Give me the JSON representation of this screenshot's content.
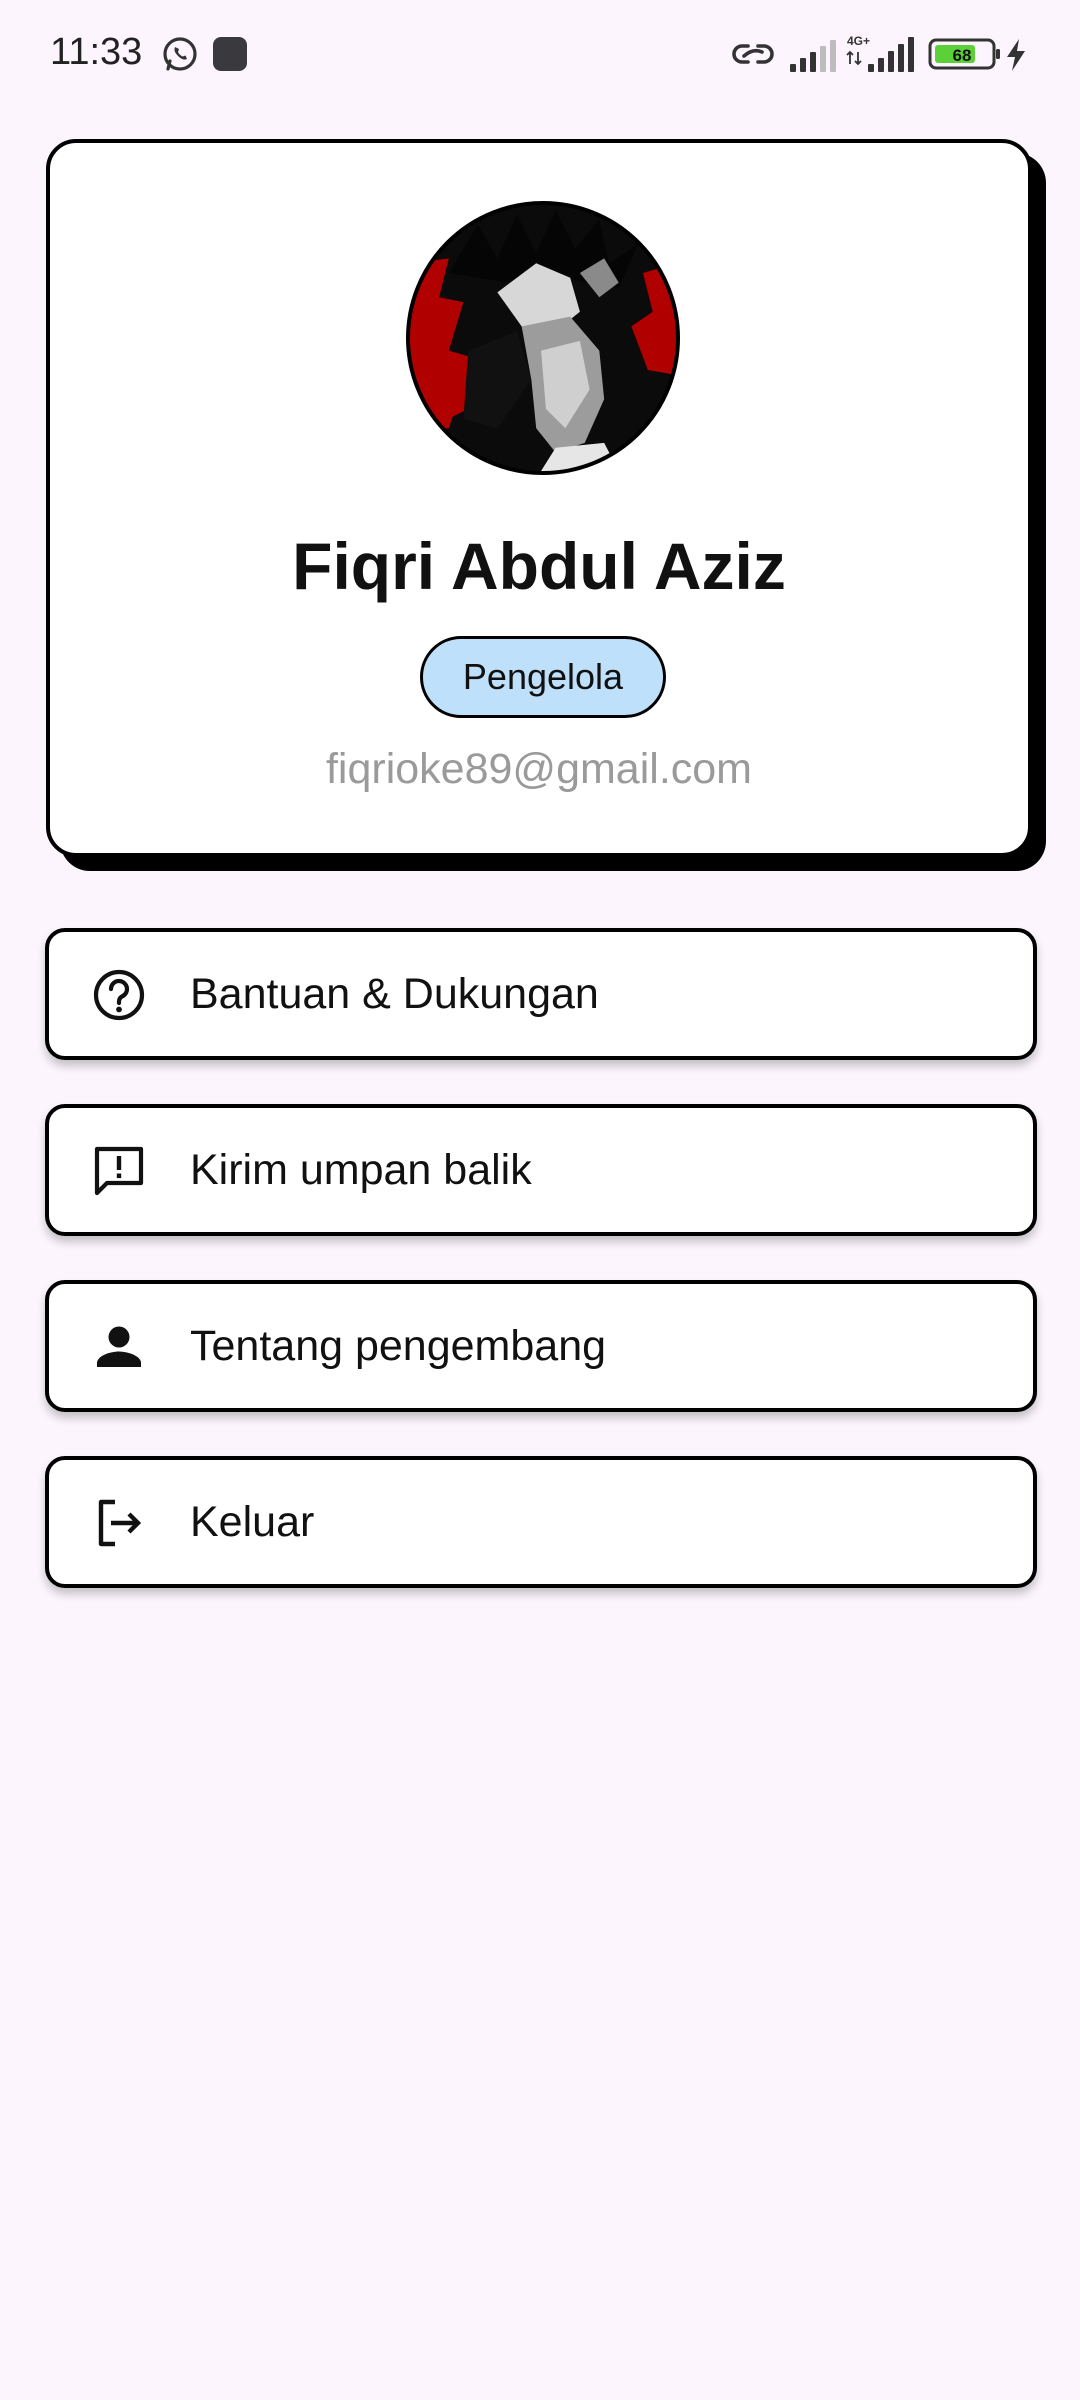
{
  "status_bar": {
    "time": "11:33",
    "battery_level": "68",
    "network_type": "4G+",
    "icons": [
      "whatsapp-icon",
      "app-notification-icon",
      "link-icon",
      "signal-icon",
      "signal-4g-icon",
      "battery-icon",
      "charging-icon"
    ]
  },
  "profile": {
    "name": "Fiqri Abdul Aziz",
    "role": "Pengelola",
    "email": "fiqrioke89@gmail.com",
    "colors": {
      "badge_background": "#bfe0fb",
      "email_text": "#9a9a9a",
      "page_background": "#fcf5fd"
    }
  },
  "menu": {
    "items": [
      {
        "label": "Bantuan & Dukungan",
        "icon": "help-circle-icon"
      },
      {
        "label": "Kirim umpan balik",
        "icon": "feedback-icon"
      },
      {
        "label": "Tentang pengembang",
        "icon": "person-icon"
      },
      {
        "label": "Keluar",
        "icon": "logout-icon"
      }
    ]
  }
}
